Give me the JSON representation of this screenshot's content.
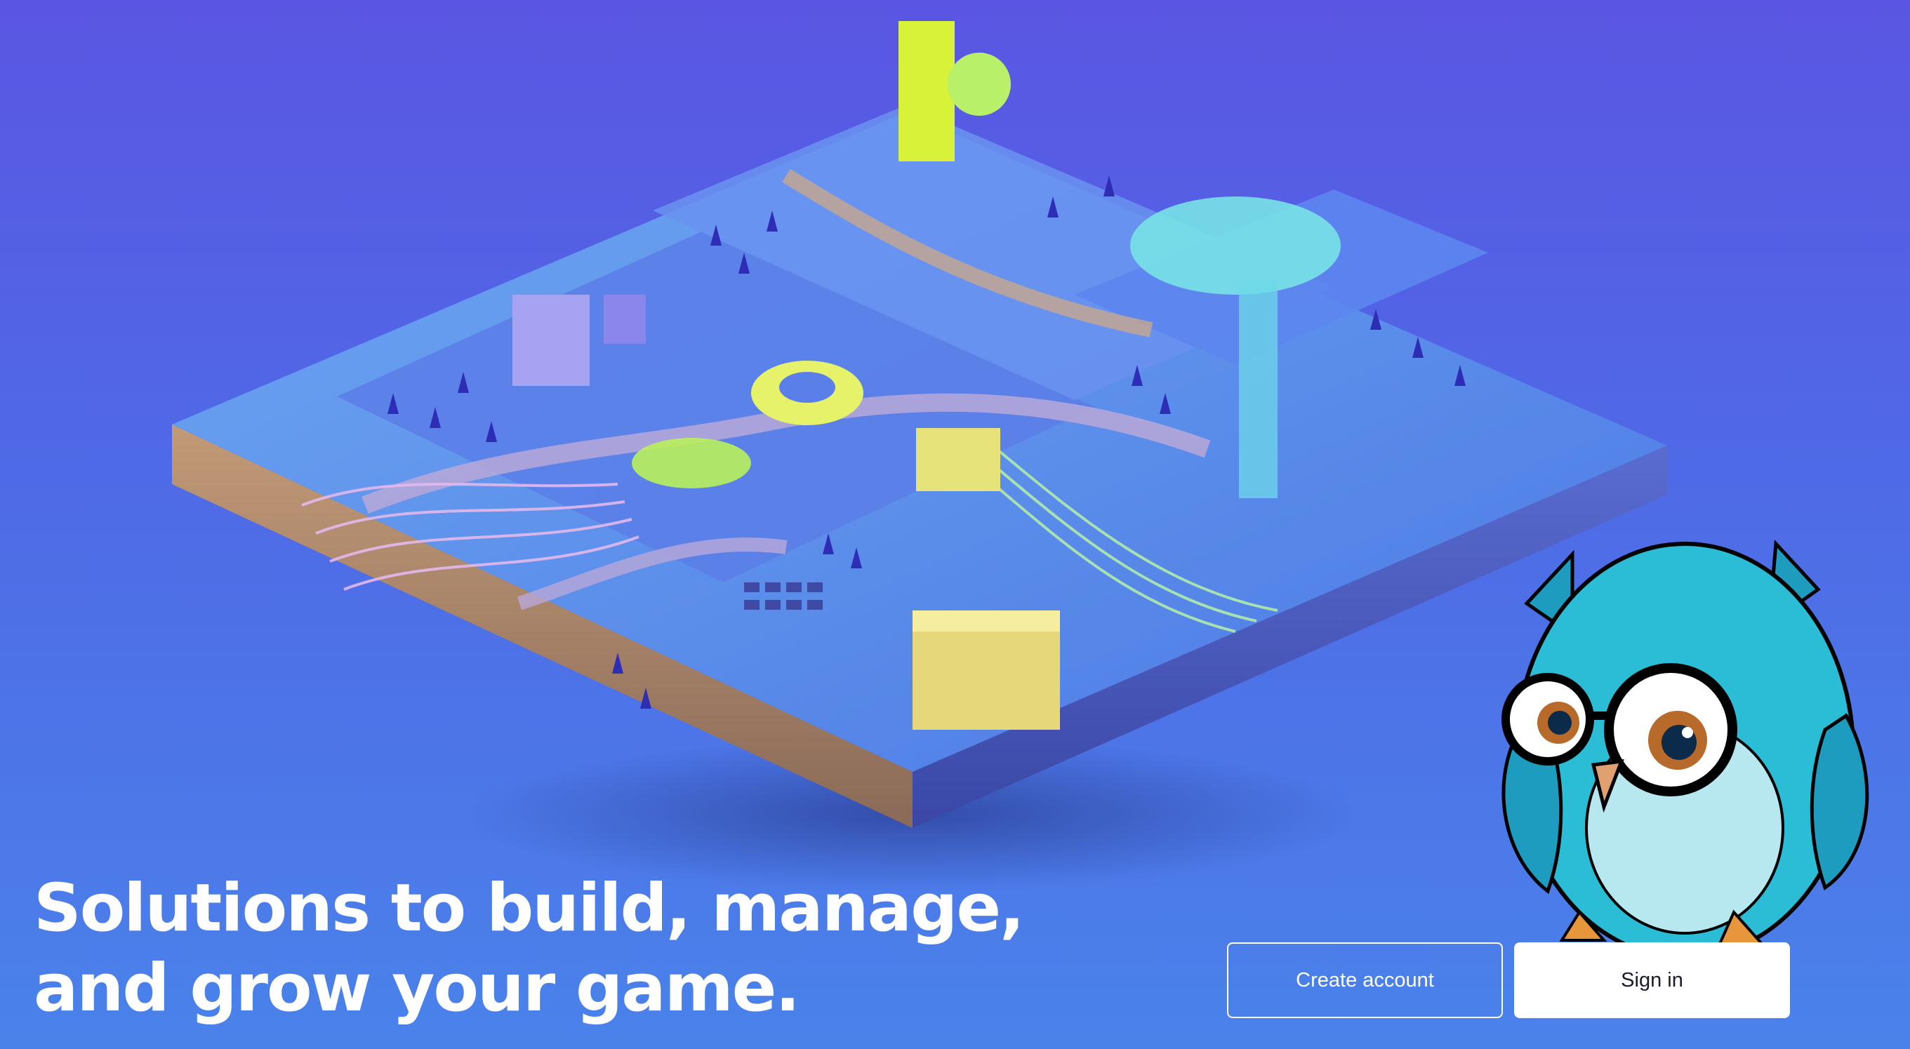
{
  "hero": {
    "headline_line1": "Solutions to build, manage,",
    "headline_line2": "and grow your game.",
    "art": "isometric-game-city-illustration",
    "mascot": "owl-mascot-with-glasses"
  },
  "actions": {
    "create_account_label": "Create account",
    "sign_in_label": "Sign in"
  },
  "colors": {
    "background_top": "#5a56e3",
    "background_bottom": "#4a82ea",
    "text": "#ffffff",
    "accent_yellow": "#d8f23a",
    "owl_teal": "#2bbcd6"
  }
}
